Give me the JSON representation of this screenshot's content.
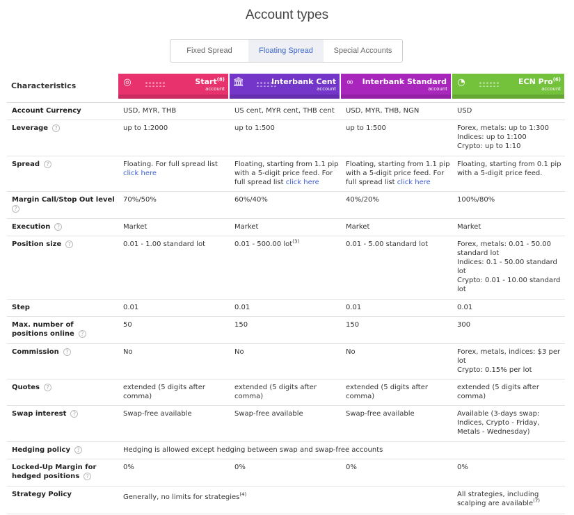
{
  "page": {
    "title": "Account types"
  },
  "tabs": [
    {
      "label": "Fixed Spread",
      "active": false
    },
    {
      "label": "Floating Spread",
      "active": true
    },
    {
      "label": "Special Accounts",
      "active": false
    }
  ],
  "table": {
    "header_label": "Characteristics",
    "accounts": [
      {
        "name": "Start",
        "sup": "(8)",
        "sub": "account",
        "color": "#e8326e",
        "icon": "circle-logo-icon"
      },
      {
        "name": "Interbank Cent",
        "sup": "",
        "sub": "account",
        "color": "#7436c8",
        "icon": "bank-icon"
      },
      {
        "name": "Interbank Standard",
        "sup": "",
        "sub": "account",
        "color": "#a926bc",
        "icon": "infinity-icon"
      },
      {
        "name": "ECN Pro",
        "sup": "(6)",
        "sub": "account",
        "color": "#74c13c",
        "icon": "timer-icon"
      }
    ],
    "rows": {
      "currency": {
        "label": "Account Currency",
        "values": [
          "USD, MYR, THB",
          "US cent, MYR cent, THB cent",
          "USD, MYR, THB, NGN",
          "USD"
        ]
      },
      "leverage": {
        "label": "Leverage",
        "values": [
          "up to 1:2000",
          "up to 1:500",
          "up to 1:500"
        ],
        "v4": [
          "Forex, metals: up to 1:300",
          "Indices: up to 1:100",
          "Crypto: up to 1:10"
        ]
      },
      "spread": {
        "label": "Spread",
        "v1": "Floating. For full spread list",
        "v2": "Floating, starting from 1.1 pip with a 5-digit price feed. For full spread list",
        "v3": "Floating, starting from 1.1 pip with a 5-digit price feed. For full spread list",
        "v4": "Floating, starting from 0.1 pip with a 5-digit price feed.",
        "link": "click here"
      },
      "margin": {
        "label": "Margin Call/Stop Out level",
        "values": [
          "70%/50%",
          "60%/40%",
          "40%/20%",
          "100%/80%"
        ]
      },
      "execution": {
        "label": "Execution",
        "values": [
          "Market",
          "Market",
          "Market",
          "Market"
        ]
      },
      "position": {
        "label": "Position size",
        "v1": "0.01 - 1.00 standard lot",
        "v2": "0.01 - 500.00 lot",
        "v2sup": "(3)",
        "v3": "0.01 - 5.00 standard lot",
        "v4": [
          "Forex, metals: 0.01 - 50.00 standard lot",
          "Indices: 0.1 - 50.00 standard lot",
          "Crypto: 0.01 - 10.00 standard lot"
        ]
      },
      "step": {
        "label": "Step",
        "values": [
          "0.01",
          "0.01",
          "0.01",
          "0.01"
        ]
      },
      "maxpos": {
        "label": "Max. number of positions online",
        "values": [
          "50",
          "150",
          "150",
          "300"
        ]
      },
      "commission": {
        "label": "Commission",
        "values": [
          "No",
          "No",
          "No"
        ],
        "v4": [
          "Forex, metals, indices: $3 per lot",
          "Crypto: 0.15% per lot"
        ]
      },
      "quotes": {
        "label": "Quotes",
        "values": [
          "extended (5 digits after comma)",
          "extended (5 digits after comma)",
          "extended (5 digits after comma)",
          "extended (5 digits after comma)"
        ]
      },
      "swap": {
        "label": "Swap interest",
        "values": [
          "Swap-free available",
          "Swap-free available",
          "Swap-free available",
          "Available (3-days swap: Indices, Crypto - Friday, Metals - Wednesday)"
        ]
      },
      "hedging": {
        "label": "Hedging policy",
        "value": "Hedging is allowed except hedging between swap and swap-free accounts"
      },
      "locked": {
        "label": "Locked-Up Margin for hedged positions",
        "values": [
          "0%",
          "0%",
          "0%",
          "0%"
        ]
      },
      "strategy": {
        "label": "Strategy Policy",
        "v1": "Generally, no limits for strategies",
        "v1sup": "(4)",
        "v4": "All strategies, including scalping are available",
        "v4sup": "(7)"
      }
    }
  }
}
